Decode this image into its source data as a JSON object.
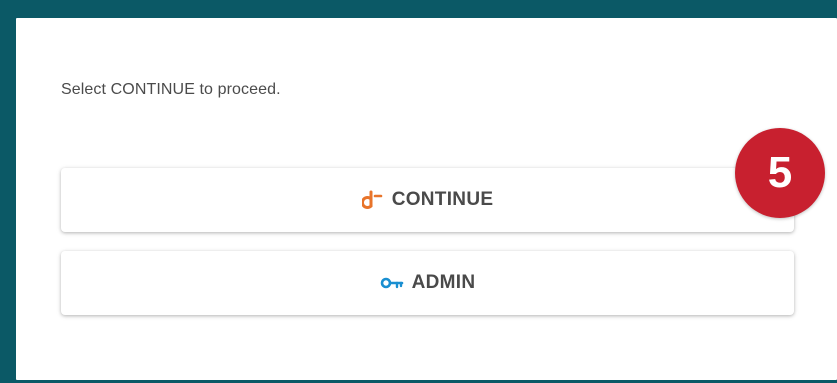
{
  "dialog": {
    "instruction": "Select CONTINUE to proceed.",
    "continue_label": "CONTINUE",
    "admin_label": "ADMIN",
    "continue_icon": "okta-arrow-icon",
    "admin_icon": "key-icon"
  },
  "badge": {
    "number": "5"
  },
  "colors": {
    "frame": "#0b5966",
    "continue_icon": "#e8742a",
    "admin_icon": "#1a8fd1",
    "badge": "#c8202f"
  }
}
